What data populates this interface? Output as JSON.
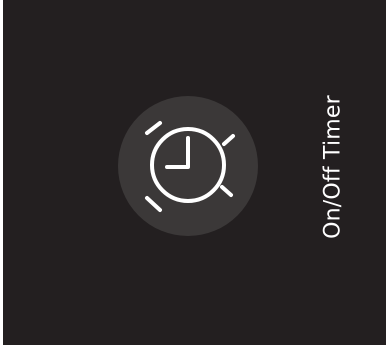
{
  "feature": {
    "label": "On/Off Timer",
    "icon": "alarm-clock-icon"
  },
  "colors": {
    "background": "#231f20",
    "icon_tile": "#3b3838",
    "foreground": "#ffffff"
  }
}
